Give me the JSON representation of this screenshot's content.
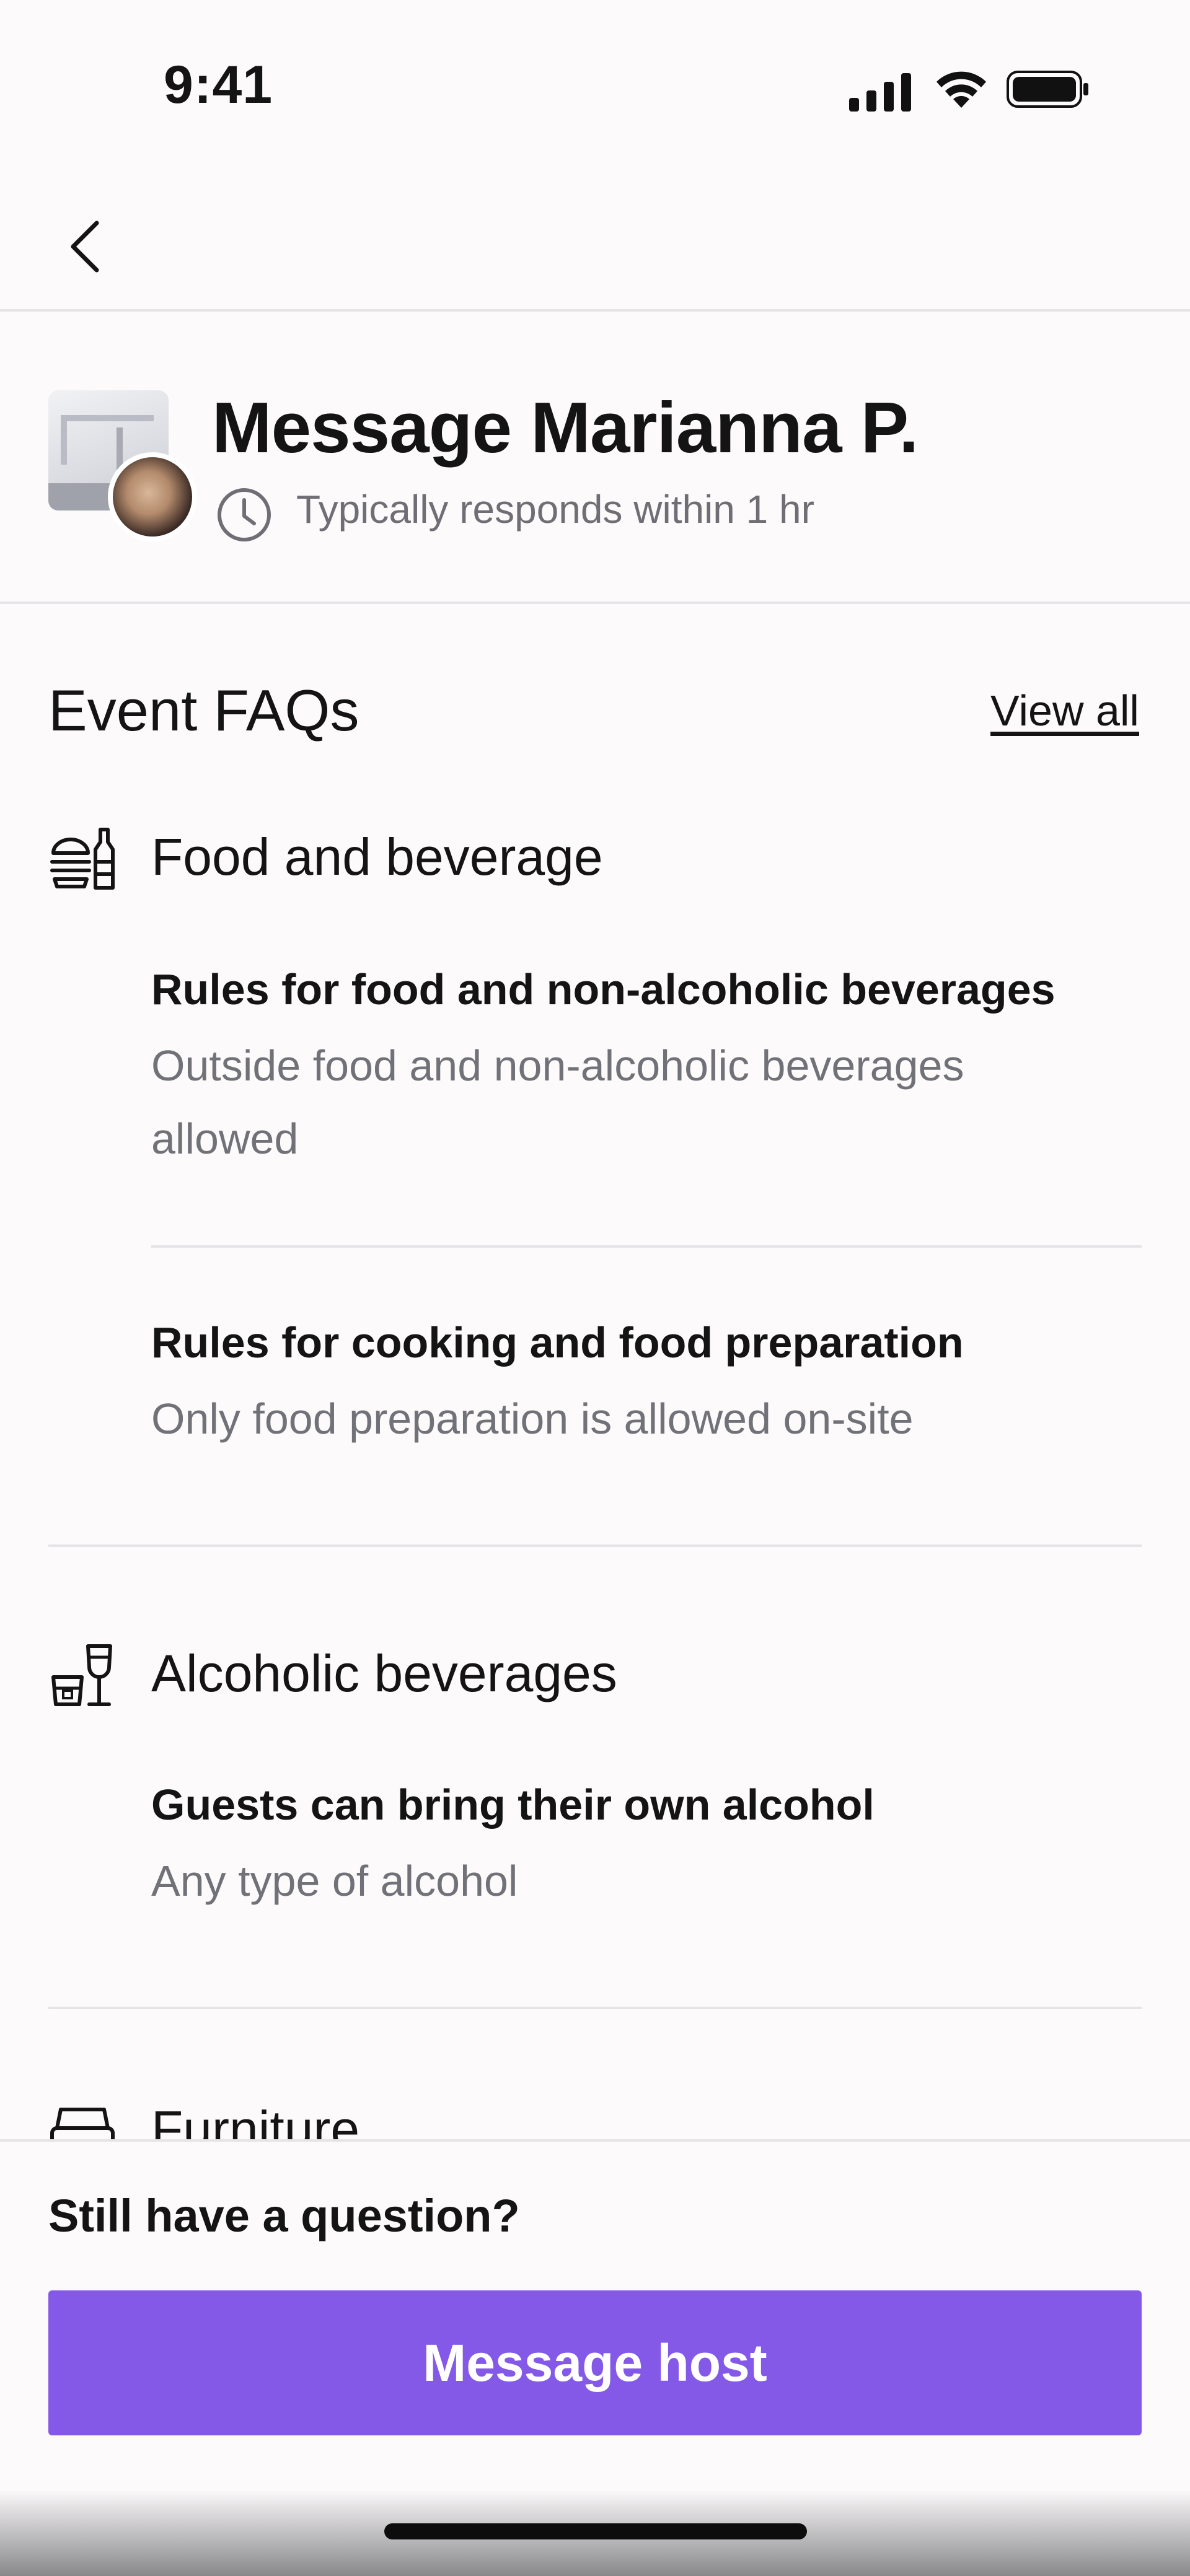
{
  "status_bar": {
    "time": "9:41"
  },
  "host": {
    "title": "Message Marianna P.",
    "response_time": "Typically responds within 1 hr"
  },
  "faqs": {
    "heading": "Event FAQs",
    "view_all_label": "View all",
    "categories": [
      {
        "title": "Food and beverage",
        "icon": "food-beverage-icon",
        "rules": [
          {
            "title": "Rules for food and non-alcoholic beverages",
            "description": "Outside food and non-alcoholic beverages allowed"
          },
          {
            "title": "Rules for cooking and food preparation",
            "description": "Only food preparation is allowed on-site"
          }
        ]
      },
      {
        "title": "Alcoholic beverages",
        "icon": "alcohol-icon",
        "rules": [
          {
            "title": "Guests can bring their own alcohol",
            "description": "Any type of alcohol"
          }
        ]
      },
      {
        "title": "Furniture",
        "icon": "furniture-icon",
        "rules": []
      }
    ]
  },
  "footer": {
    "question_label": "Still have a question?",
    "message_button_label": "Message host"
  },
  "colors": {
    "accent": "#8459e8",
    "text_primary": "#141414",
    "text_secondary": "#717178",
    "divider": "#e6e4e6",
    "background": "#fcfafb"
  }
}
